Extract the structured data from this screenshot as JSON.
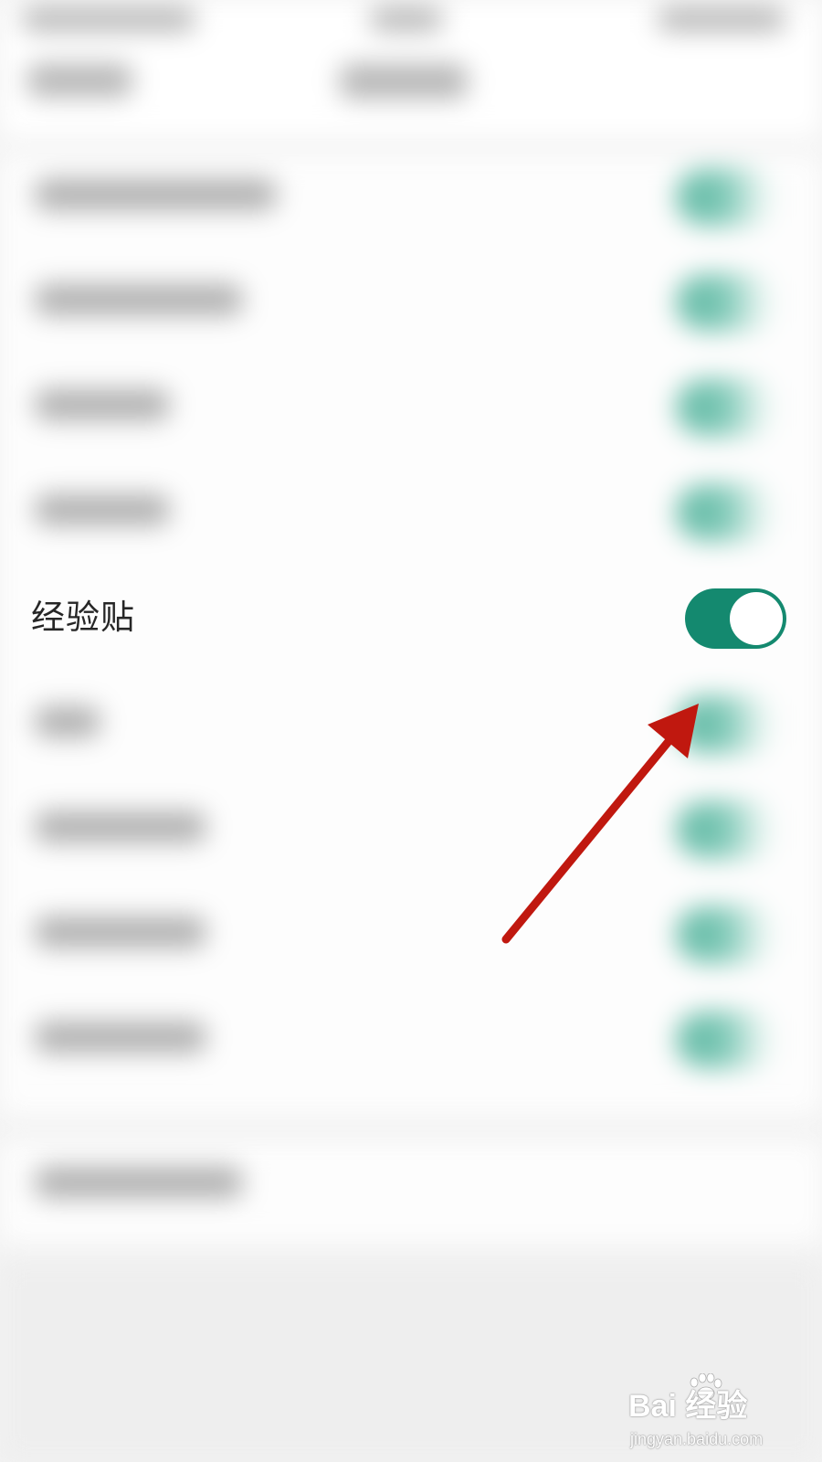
{
  "settings": {
    "highlighted_item": {
      "label": "经验贴",
      "toggle_on": true,
      "toggle_color": "#14896f"
    },
    "blurred_rows_toggle_color": "#6fc2ae"
  },
  "annotation": {
    "arrow_color": "#c0180f"
  },
  "watermark": {
    "brand_text": "Bai  经验",
    "url_text": "jingyan.baidu.com",
    "logo_icon": "baidu-paw-icon"
  }
}
